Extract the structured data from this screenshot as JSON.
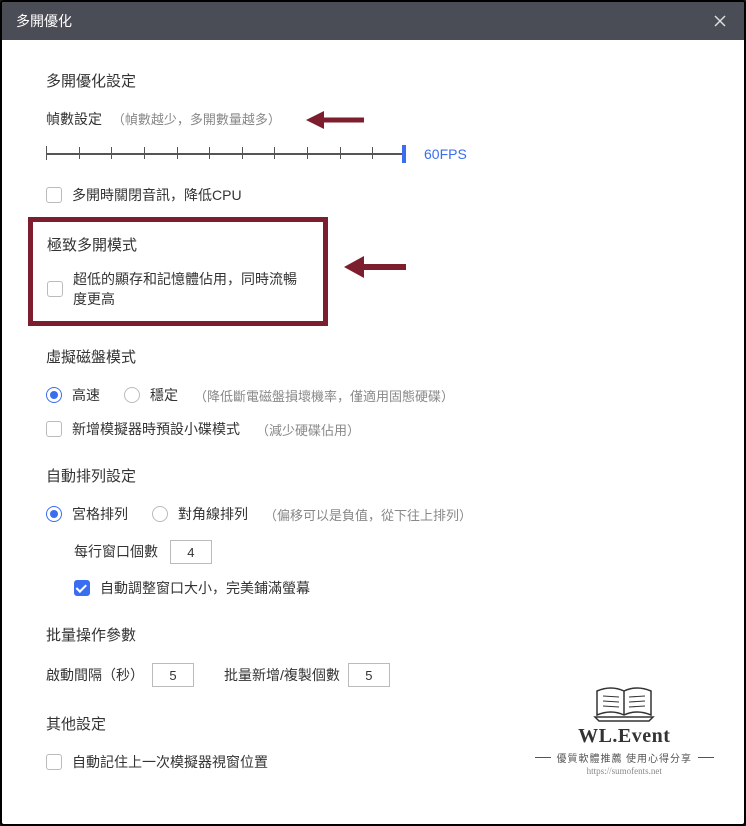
{
  "window": {
    "title": "多開優化"
  },
  "section1": {
    "title": "多開優化設定",
    "fps_label_prefix": "幀數設定",
    "fps_label_hint": "（幀數越少，多開數量越多）",
    "fps_value": "60FPS",
    "mute_label": "多開時關閉音訊，降低CPU"
  },
  "section2": {
    "title": "極致多開模式",
    "low_mem_label": "超低的顯存和記憶體佔用，同時流暢度更高"
  },
  "section3": {
    "title": "虛擬磁盤模式",
    "fast_label": "高速",
    "stable_label": "穩定",
    "stable_hint": "（降低斷電磁盤損壞機率，僅適用固態硬碟）",
    "small_disk_label": "新增模擬器時預設小碟模式",
    "small_disk_hint": "（減少硬碟佔用）"
  },
  "section4": {
    "title": "自動排列設定",
    "grid_label": "宮格排列",
    "diag_label": "對角線排列",
    "diag_hint": "（偏移可以是負值，從下往上排列）",
    "per_row_label": "每行窗口個數",
    "per_row_value": "4",
    "auto_resize_label": "自動調整窗口大小，完美鋪滿螢幕"
  },
  "section5": {
    "title": "批量操作參數",
    "interval_label": "啟動間隔（秒）",
    "interval_value": "5",
    "copy_label": "批量新增/複製個數",
    "copy_value": "5"
  },
  "section6": {
    "title": "其他設定",
    "remember_label": "自動記住上一次模擬器視窗位置"
  },
  "watermark": {
    "brand": "WL.Event",
    "sub": "優質軟體推薦 使用心得分享",
    "url": "https://sumofents.net"
  }
}
